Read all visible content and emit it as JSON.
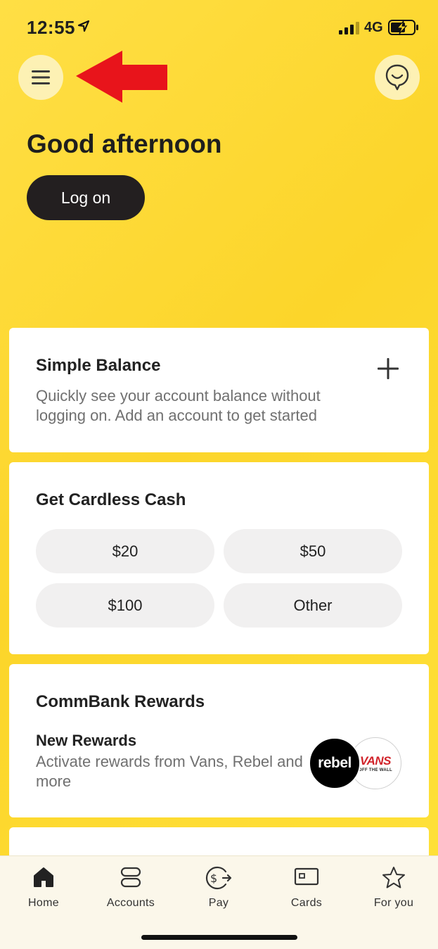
{
  "status_bar": {
    "time": "12:55",
    "network": "4G"
  },
  "header": {
    "greeting": "Good afternoon",
    "logon_label": "Log on"
  },
  "simple_balance": {
    "title": "Simple Balance",
    "description": "Quickly see your account balance without logging on. Add an account to get started"
  },
  "cardless_cash": {
    "title": "Get Cardless Cash",
    "amounts": [
      "$20",
      "$50",
      "$100",
      "Other"
    ]
  },
  "rewards": {
    "title": "CommBank Rewards",
    "item_title": "New Rewards",
    "item_description": "Activate rewards from Vans, Rebel and more",
    "logos": {
      "rebel": "rebel",
      "vans": "VANS",
      "vans_tag": "OFF THE WALL"
    }
  },
  "tabs": [
    {
      "label": "Home",
      "icon": "home-icon"
    },
    {
      "label": "Accounts",
      "icon": "accounts-icon"
    },
    {
      "label": "Pay",
      "icon": "pay-icon"
    },
    {
      "label": "Cards",
      "icon": "cards-icon"
    },
    {
      "label": "For you",
      "icon": "star-icon"
    }
  ],
  "colors": {
    "brand_yellow": "#FCD52A",
    "annotation_red": "#E8141B",
    "button_dark": "#231F20"
  }
}
